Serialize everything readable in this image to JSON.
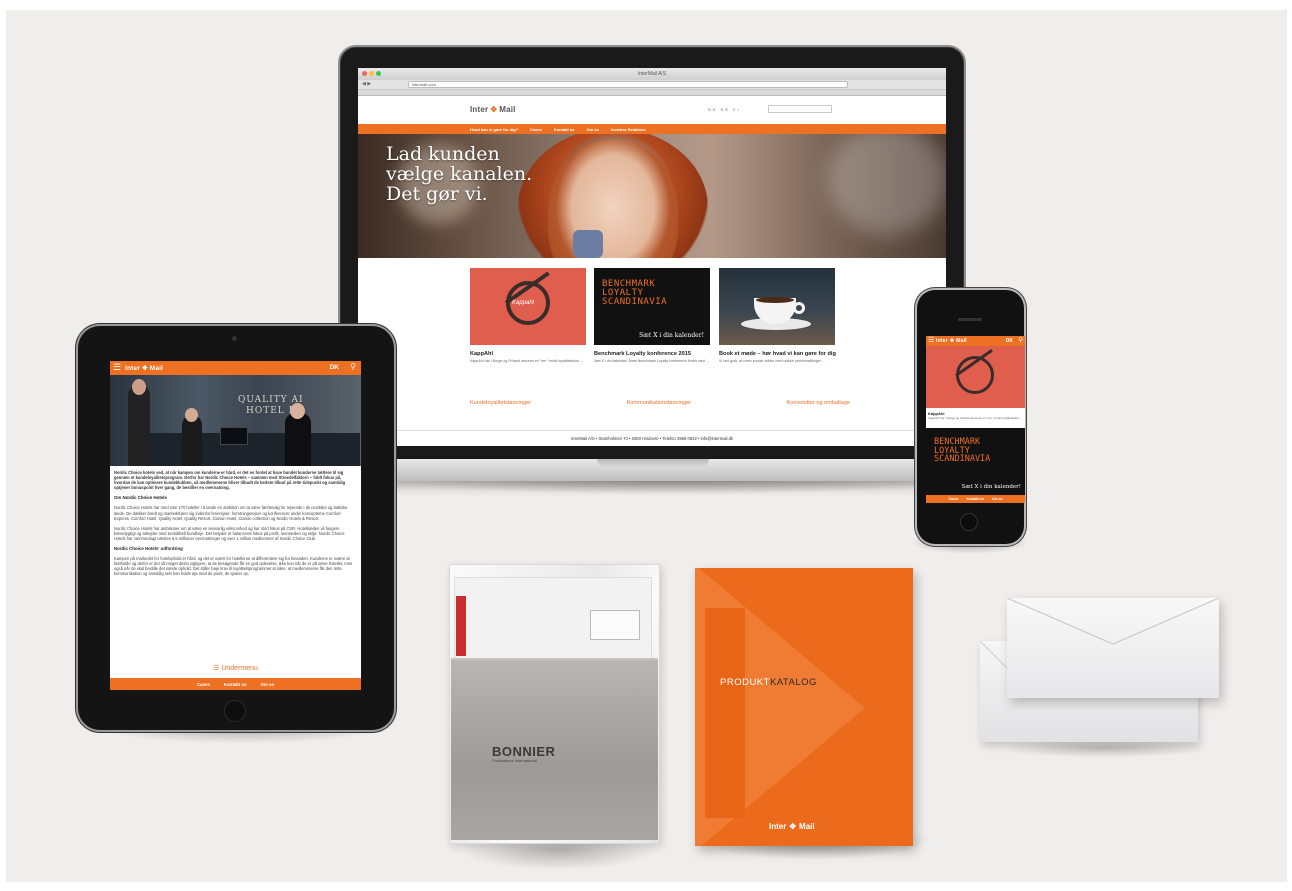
{
  "brand": {
    "accent": "#ee7023",
    "logo_left": "Inter",
    "logo_right": "Mail",
    "logo_icon": "intermail-arrows-icon"
  },
  "laptop": {
    "window_title": "InterMail A/S",
    "url": "intermail.com",
    "language_links": "DK SE FI",
    "nav": [
      "Hvad kan vi gøre for dig?",
      "Cases",
      "Kontakt os",
      "Om os",
      "Investor Relations"
    ],
    "hero_lines": [
      "Lad kunden",
      "vælge kanalen.",
      "Det gør vi."
    ],
    "cards": [
      {
        "title": "KappAhl",
        "text": "KappAhl har i Norge og Finland lanceret en \"ren\" mobil loyalitetsklub ...",
        "image_word": "Kappahl"
      },
      {
        "title": "Benchmark Loyalty konference 2015",
        "text": "Sæt X i din kalender! Årets Benchmark Loyalty konference finder sted ...",
        "bench_lines": [
          "BENCHMARK",
          "LOYALTY",
          "SCANDINAVIA"
        ],
        "bench_tag": "Sæt X i din kalender!"
      },
      {
        "title": "Book et møde – hør hvad vi kan gøre for dig",
        "text": "Vi ved godt, at vores kunder sidder med unikke problemstillinger ..."
      }
    ],
    "service_links": [
      "Kundeloyalitetsløsninger",
      "Kommunikationsløsninger",
      "Konvolutter og emballage"
    ],
    "footer": "InterMail A/S  •  Stamholmen 70  •  2650 Hvidovre  •  Telefon 3966 0922  •  info@intermail.dk"
  },
  "tablet": {
    "lang": "DK",
    "photo_sign": [
      "QUALITY AI",
      "HOTEL DA"
    ],
    "intro": "Nordic Choice hotels ved, at når kampen om kunderne er hård, er det en fordel at have bundet kunderne tættere til sig gennem et kundeloyalitetsprogram. Derfor har Nordic Choice Hotels – sammen med Stroedelfaktorn – fuldt fokus på, hvordan de kan optimere kundeklubben, så medlemmerne bliver tilbudt de bedste tilbud på rette tidspunkt og samtidig optjener bonuspoint hver gang, de bestiller en overnatning.",
    "h1": "Om Nordic Choice Hotels",
    "p1": "Nordic Choice Hotels har med sine 170 hoteller i 5 lande en ambition om at være førstevalg for rejsende i de nordiske og baltiske lande. De dækker bredt og markedsfører sig indenfor ferierejser, forretningsrejser og konferencer under koncepterne Comfort Express, Comfort Hotel, Quality Hotel, Quality Resort, Clarion Hotel, Clarion collection og Nordic Hotels & Resort.",
    "p2": "Nordic Choice Hotels har ambitioner om at være en ansvarlig virksomhed og har stort fokus på CSR. Hotelkæden vil fungere bæredygtigt og arbejder med tredobbelt bundlinje. Det betyder et balanceret fokus på profit, mennesker og miljø. Nordic Choice Hotels har sammenlagt næsten 6,5 millioner overnatninger og over 1 million medlemmer af Nordic Choice Club.",
    "h2": "Nordic Choice Hotels' udfordring",
    "p3": "Kampen på markedet for hotelophold er hård, og det er svært for hotellerne at differentiere sig fra hinanden. Kunderne er svære at fastholde og derfor er det så meget desto vigtigere, at de besøgende får en god oplevelse, ikke kun når de er på selve hotellet, men også når de skal bestille det næste ophold. Det stiller høje krav til loyalitetsprogrammet at sikre, at medlemmerne får den rette kommunikation og samtidig selv kan holde øje med de point, de sparer op.",
    "submenu": "Undermenu",
    "bottom_nav": [
      "Cases",
      "Kontakt os",
      "Om os"
    ]
  },
  "phone": {
    "lang": "DK",
    "card_title": "KappAhl",
    "card_text": "KappAhl har i Norge og Finland lanceret en \"ren\" mobil loyalitetsklub ...",
    "bench_lines": [
      "BENCHMARK",
      "LOYALTY",
      "SCANDINAVIA"
    ],
    "bench_tag": "Sæt X i din kalender!",
    "bottom_nav": [
      "Cases",
      "Kontakt os",
      "Om os"
    ]
  },
  "bag": {
    "logo": "BONNIER",
    "sub": "Publications International"
  },
  "catalog": {
    "title_a": "PRODUKT",
    "title_b": "KATALOG"
  }
}
